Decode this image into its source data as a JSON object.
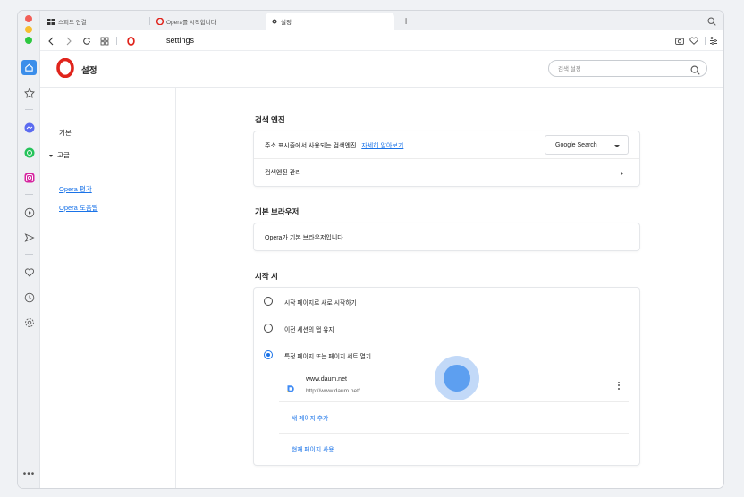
{
  "tabs": [
    {
      "label": "스피드 연결",
      "icon": "grid-icon"
    },
    {
      "label": "Opera를 시작합니다",
      "icon": "opera-logo"
    },
    {
      "label": "설정",
      "icon": "gear-icon"
    }
  ],
  "addressbar": {
    "url": "settings"
  },
  "header": {
    "title": "설정",
    "search_placeholder": "검색 설정"
  },
  "menu": {
    "basic": "기본",
    "advanced": "고급",
    "rate_opera": "Opera 평가",
    "opera_help": "Opera 도움말"
  },
  "search_engine": {
    "section_title": "검색 엔진",
    "address_bar_label": "주소 표시줄에서 사용되는 검색엔진",
    "learn_more": "자세히 알아보기",
    "selected_engine": "Google Search",
    "manage_label": "검색엔진 관리"
  },
  "default_browser": {
    "section_title": "기본 브라우저",
    "status": "Opera가 기본 브라우저입니다"
  },
  "on_startup": {
    "section_title": "시작 시",
    "options": [
      {
        "label": "시작 페이지로 새로 시작하기",
        "checked": false
      },
      {
        "label": "이전 세션의 탭 유지",
        "checked": false
      },
      {
        "label": "특정 페이지 또는 페이지 세트 열기",
        "checked": true
      }
    ],
    "pages": [
      {
        "title": "www.daum.net",
        "url": "http://www.daum.net/"
      }
    ],
    "add_page": "새 페이지 추가",
    "use_current": "현재 페이지 사용"
  },
  "colors": {
    "accent": "#1a73e8",
    "opera_red": "#e0241c"
  }
}
